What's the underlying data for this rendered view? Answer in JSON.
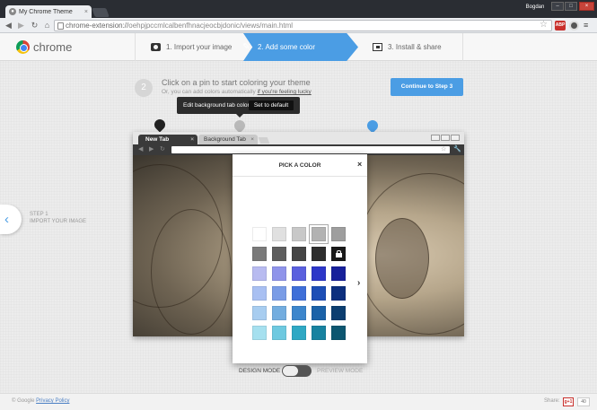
{
  "browser": {
    "tab_title": "My Chrome Theme",
    "tab_close": "×",
    "profile_name": "Bogdan",
    "url_scheme": "chrome-extension://",
    "url_rest": "oehpjpccmlcalbenfhnacjeocbjdonic/views/main.html",
    "abp_label": "ABP",
    "window_buttons": [
      "–",
      "□",
      "×"
    ]
  },
  "header": {
    "logo_text": "chrome",
    "steps": [
      {
        "label": "1. Import your image"
      },
      {
        "label": "2. Add some color"
      },
      {
        "label": "3. Install & share"
      }
    ]
  },
  "instructions": {
    "step_number": "2",
    "main": "Click on a pin to start coloring your theme",
    "sub_prefix": "Or, you can add colors automatically ",
    "sub_link": "if you're feeling lucky",
    "continue_button": "Continue to Step 3"
  },
  "tooltip": {
    "label": "Edit background tab color",
    "button": "Set to default"
  },
  "mock_browser": {
    "tab_active": "New Tab",
    "tab_background": "Background Tab",
    "tab_close": "×"
  },
  "picker": {
    "title": "PICK A COLOR",
    "close": "×",
    "next": "›",
    "swatches": [
      [
        "#ffffff",
        "#e0e0e0",
        "#c8c8c8",
        "#b2b2b2",
        "#9e9e9e"
      ],
      [
        "#7a7a7a",
        "#5e5e5e",
        "#454545",
        "#2e2e2e",
        "#1a1a1a"
      ],
      [
        "#b8bbf0",
        "#8f94ea",
        "#5a60de",
        "#2d37c8",
        "#17209a"
      ],
      [
        "#a9c0f2",
        "#7a9ce6",
        "#3f6fd8",
        "#1d4eb6",
        "#0d2f7e"
      ],
      [
        "#a8cdf0",
        "#73addf",
        "#3d86cc",
        "#1b62a8",
        "#0c3e70"
      ],
      [
        "#a6e0ef",
        "#6ec9e0",
        "#2fa8c4",
        "#1882a0",
        "#0c5670"
      ]
    ],
    "selected_swatch": "#b2b2b2",
    "locked_swatch": "#1a1a1a"
  },
  "prev": {
    "arrow": "‹",
    "line1": "STEP 1",
    "line2": "IMPORT YOUR IMAGE"
  },
  "mode": {
    "design": "DESIGN MODE",
    "preview": "PREVIEW MODE"
  },
  "footer": {
    "copyright": "© Google ",
    "privacy": "Privacy Policy",
    "share_label": "Share:",
    "gplus": "g+1",
    "count": "40"
  }
}
